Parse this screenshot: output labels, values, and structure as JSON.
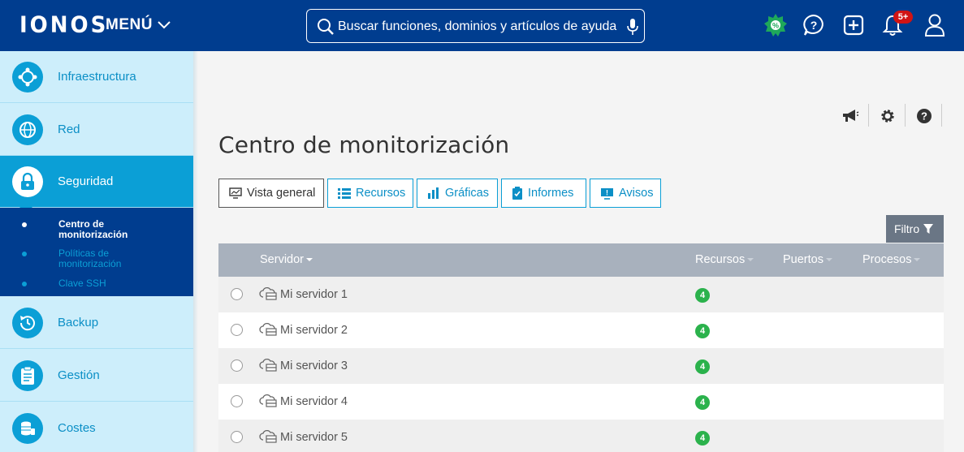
{
  "topbar": {
    "logo": "IONOS",
    "menu_label": "MENÚ",
    "search_placeholder": "Buscar funciones, dominios y artículos de ayuda",
    "notification_count": "5+",
    "colors": {
      "bar": "#003d8f",
      "promo": "#1fa85a",
      "badge": "#d01414"
    },
    "icons": [
      "promo-badge-icon",
      "help-chat-icon",
      "add-icon",
      "bell-icon",
      "user-icon"
    ]
  },
  "sidebar": {
    "items": [
      {
        "label": "Infraestructura",
        "icon": "infrastructure-icon"
      },
      {
        "label": "Red",
        "icon": "network-globe-icon"
      },
      {
        "label": "Seguridad",
        "icon": "lock-icon",
        "active": true
      },
      {
        "label": "Backup",
        "icon": "backup-clock-icon"
      },
      {
        "label": "Gestión",
        "icon": "clipboard-icon"
      },
      {
        "label": "Costes",
        "icon": "coins-icon"
      }
    ],
    "subitems": [
      {
        "label": "Centro de monitorización",
        "line1": "Centro de",
        "line2": "monitorización",
        "current": true
      },
      {
        "label": "Políticas de monitorización",
        "line1": "Políticas de",
        "line2": "monitorización",
        "current": false
      },
      {
        "label": "Clave SSH",
        "line1": "Clave SSH",
        "line2": "",
        "current": false
      }
    ]
  },
  "main": {
    "title": "Centro de monitorización",
    "tabs": [
      {
        "label": "Vista general",
        "icon": "monitor-chart-icon",
        "selected": true
      },
      {
        "label": "Recursos",
        "icon": "list-icon"
      },
      {
        "label": "Gráficas",
        "icon": "bar-chart-icon"
      },
      {
        "label": "Informes",
        "icon": "report-clipboard-icon"
      },
      {
        "label": "Avisos",
        "icon": "alert-monitor-icon"
      }
    ],
    "filter_label": "Filtro",
    "table": {
      "columns": [
        "Servidor",
        "Recursos",
        "Puertos",
        "Procesos"
      ],
      "rows": [
        {
          "name": "Mi servidor 1",
          "resources": "4"
        },
        {
          "name": "Mi servidor 2",
          "resources": "4"
        },
        {
          "name": "Mi servidor 3",
          "resources": "4"
        },
        {
          "name": "Mi servidor 4",
          "resources": "4"
        },
        {
          "name": "Mi servidor 5",
          "resources": "4"
        }
      ]
    }
  }
}
